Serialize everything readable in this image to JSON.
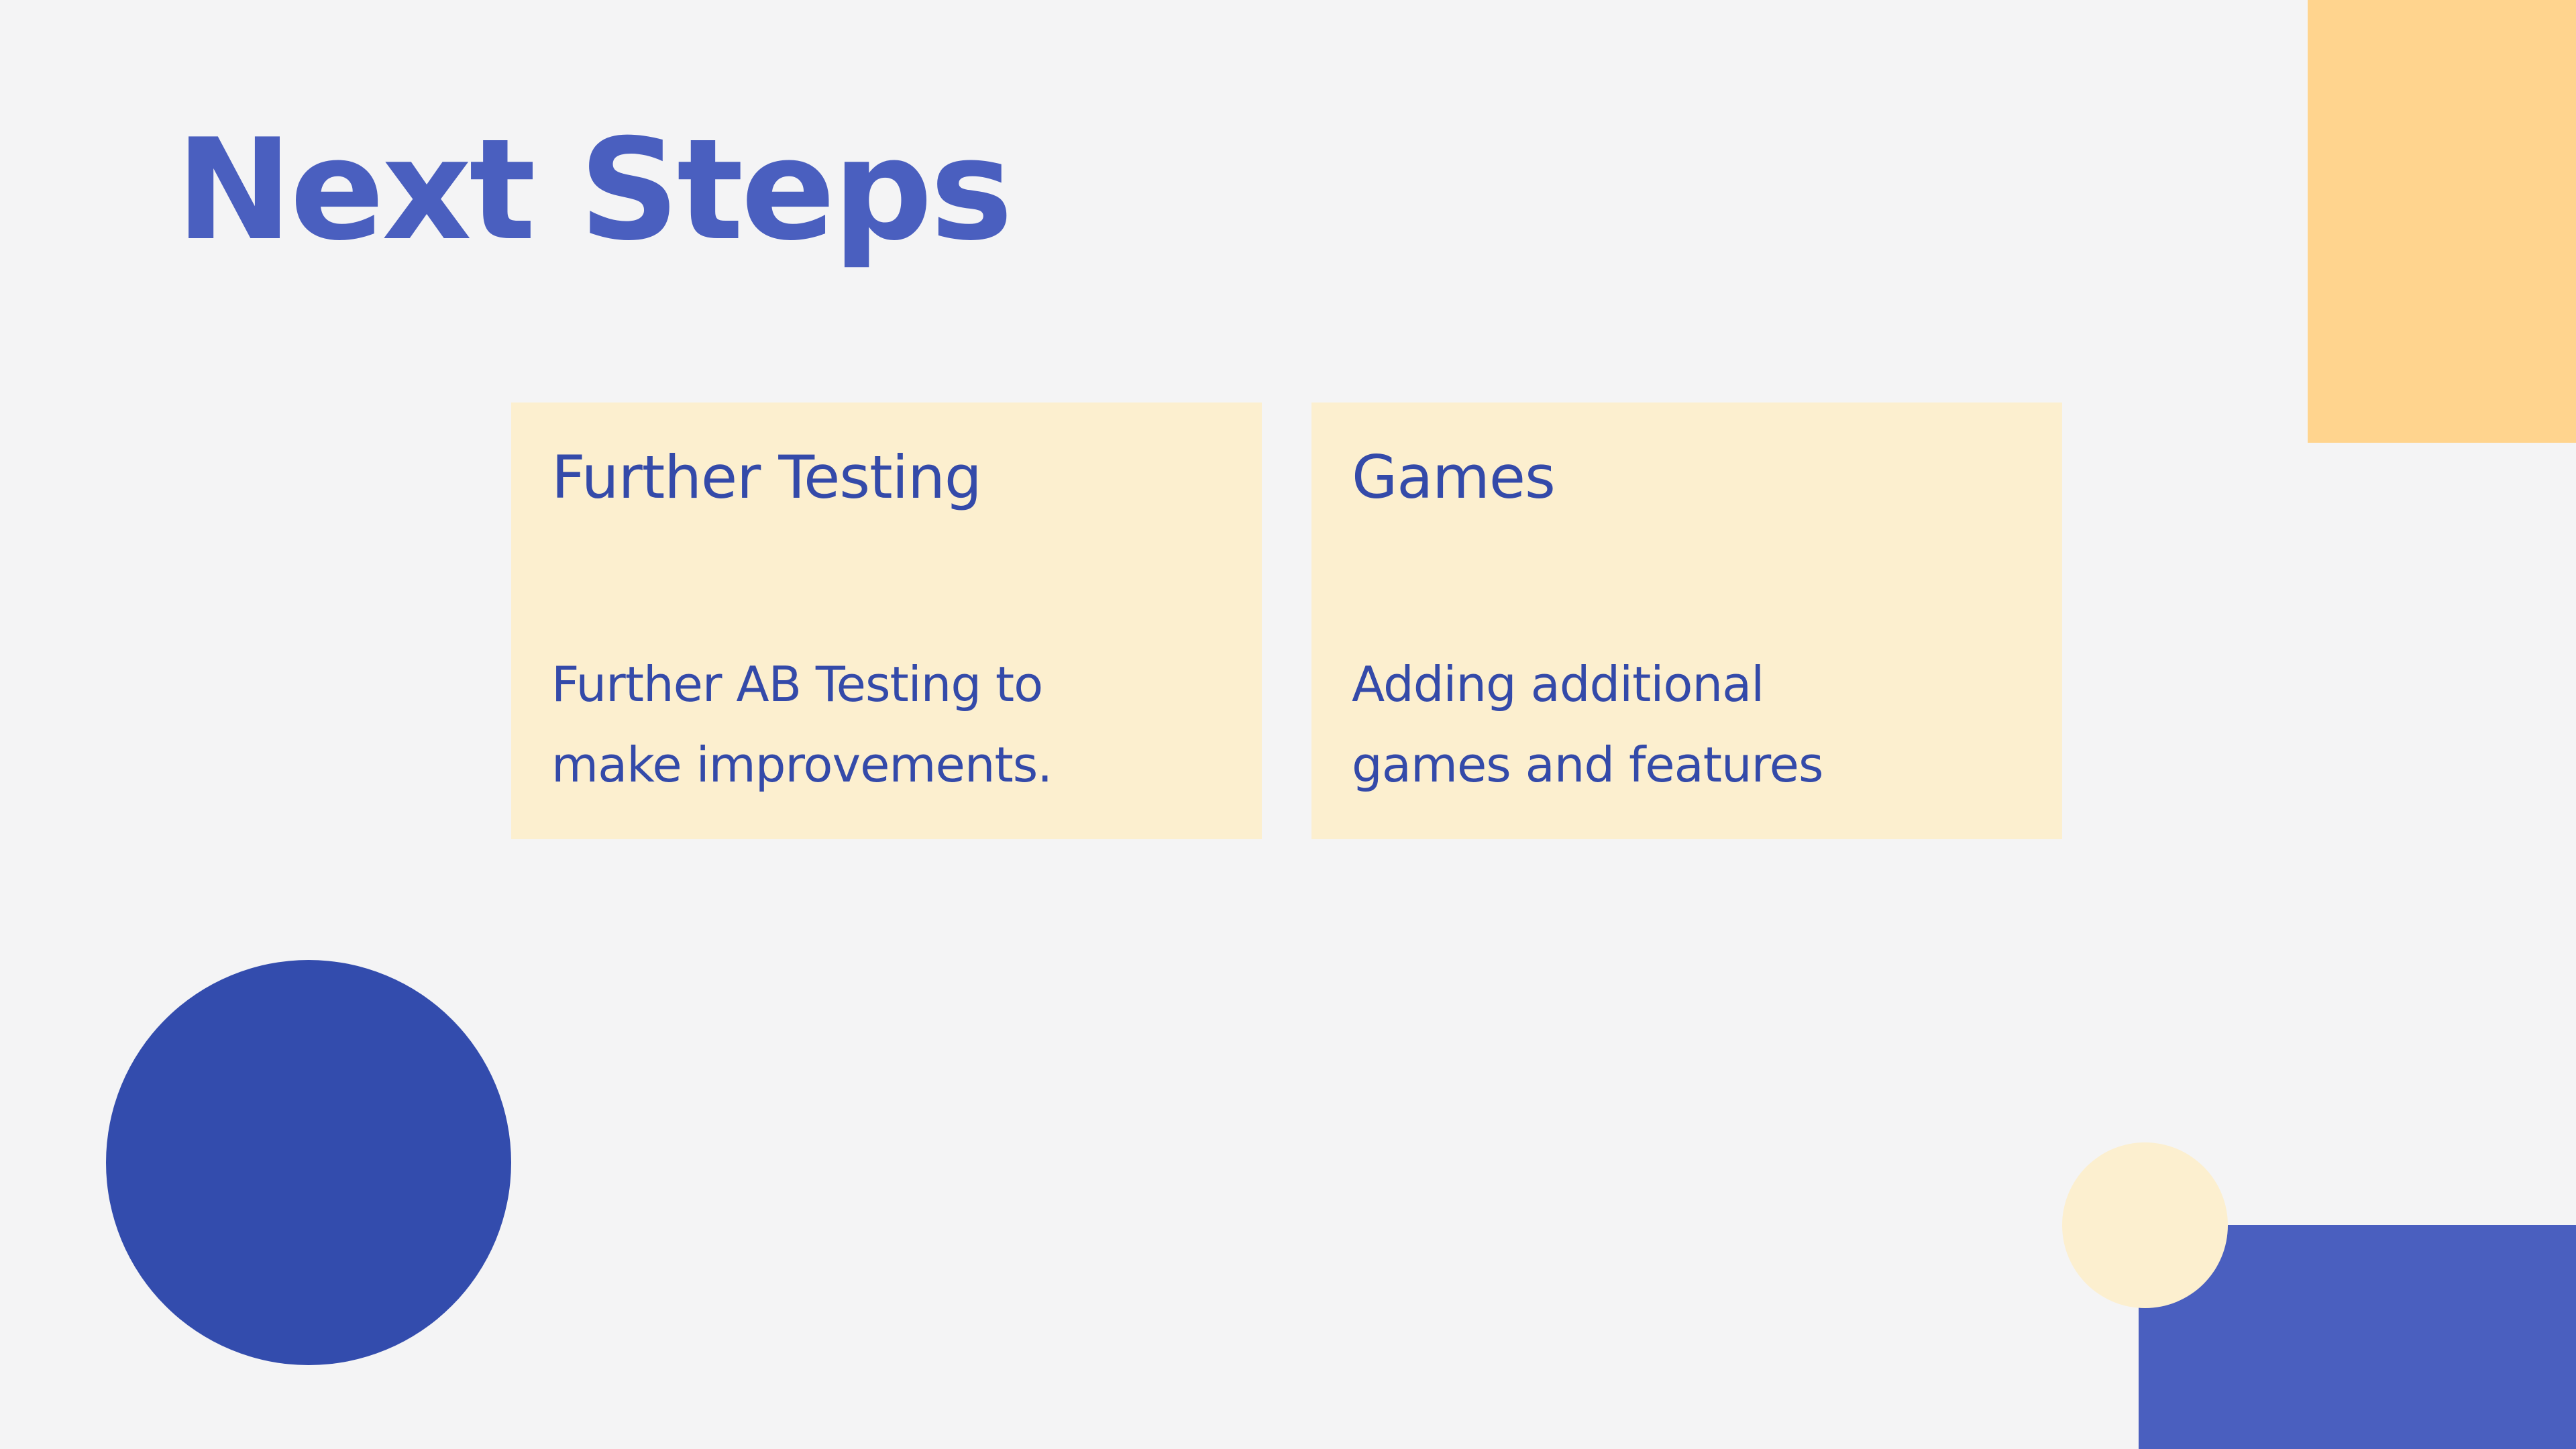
{
  "slide": {
    "title": "Next Steps",
    "cards": [
      {
        "heading": "Further Testing",
        "body_lines": [
          "Further AB Testing to",
          "make improvements."
        ]
      },
      {
        "heading": "Games",
        "body_lines": [
          "Adding additional",
          "games and features"
        ]
      }
    ]
  },
  "colors": {
    "background": "#f4f4f5",
    "title": "#4a5fbf",
    "card_fill": "#fcefcf",
    "card_text": "#344aa9",
    "orange_accent": "#ffd48e",
    "blue_circle": "#334cad",
    "blue_block": "#4a5fbf",
    "cream_circle": "#fcefcf"
  }
}
